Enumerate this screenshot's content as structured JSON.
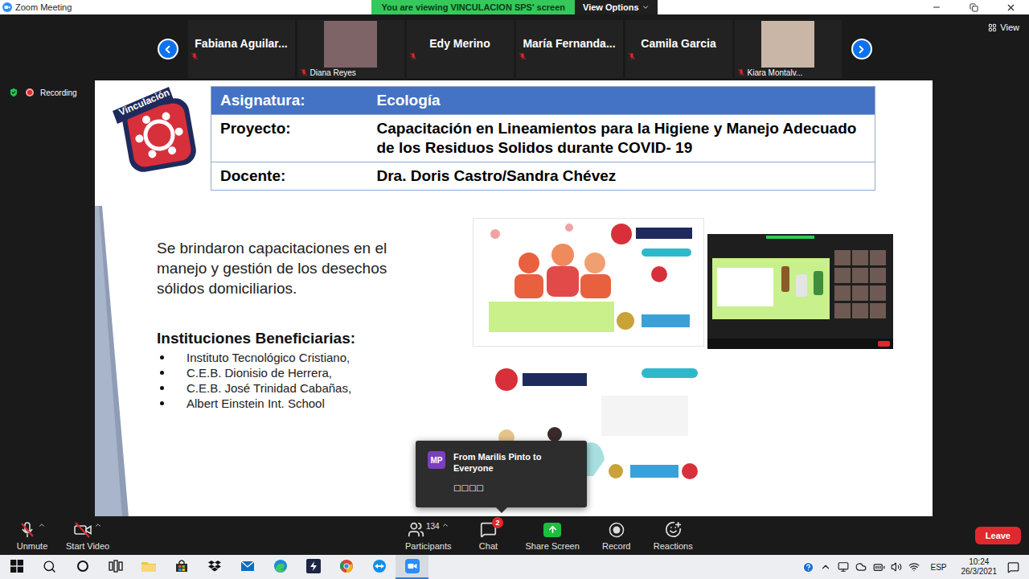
{
  "window": {
    "title": "Zoom Meeting"
  },
  "share_banner": {
    "text": "You are viewing VINCULACION SPS' screen",
    "view_options": "View Options"
  },
  "view_button": {
    "label": "View"
  },
  "recording": {
    "label": "Recording",
    "active": true
  },
  "participants": [
    {
      "name": "Fabiana Aguilar...",
      "kind": "name",
      "muted": true
    },
    {
      "name": "Diana Reyes",
      "kind": "photo",
      "muted": true
    },
    {
      "name": "Edy Merino",
      "kind": "name",
      "muted": true
    },
    {
      "name": "María Fernanda...",
      "kind": "name",
      "muted": true
    },
    {
      "name": "Camila Garcia",
      "kind": "name",
      "muted": true
    },
    {
      "name": "Kiara Montalv...",
      "kind": "photo",
      "muted": true
    }
  ],
  "slide": {
    "logo": "Vinculación",
    "table": [
      {
        "label": "Asignatura:",
        "value": "Ecología",
        "header": true
      },
      {
        "label": "Proyecto:",
        "value": "Capacitación en Lineamientos para la Higiene y Manejo Adecuado de los Residuos Solidos durante COVID- 19",
        "header": false
      },
      {
        "label": "Docente:",
        "value": "Dra. Doris Castro/Sandra Chévez",
        "header": false
      }
    ],
    "description": "Se brindaron capacitaciones en el manejo y gestión de los desechos sólidos domiciliarios.",
    "beneficiaries_title": "Instituciones Beneficiarias:",
    "beneficiaries": [
      "Instituto Tecnológico Cristiano,",
      "C.E.B. Dionisio de Herrera,",
      "C.E.B. José Trinidad Cabañas,",
      "Albert Einstein Int. School"
    ],
    "images": [
      {
        "kind": "hygiene"
      },
      {
        "kind": "screenshot"
      },
      {
        "kind": "waste"
      }
    ]
  },
  "chat_toast": {
    "avatar": "MP",
    "from": "From Marilis Pinto to Everyone",
    "message": "□□□□"
  },
  "toolbar": {
    "left": [
      {
        "label": "Unmute",
        "kind": "mic",
        "off": true
      },
      {
        "label": "Start Video",
        "kind": "video",
        "off": true
      }
    ],
    "center": [
      {
        "label": "Participants",
        "kind": "participants",
        "count": "134"
      },
      {
        "label": "Chat",
        "kind": "chat",
        "badge": "2"
      },
      {
        "label": "Share Screen",
        "kind": "share"
      },
      {
        "label": "Record",
        "kind": "record"
      },
      {
        "label": "Reactions",
        "kind": "reactions"
      }
    ],
    "leave": "Leave"
  },
  "taskbar": {
    "apps": [
      {
        "kind": "start",
        "active": false
      },
      {
        "kind": "search",
        "active": false
      },
      {
        "kind": "cortana",
        "active": false
      },
      {
        "kind": "taskview",
        "active": false
      },
      {
        "kind": "explorer",
        "active": false
      },
      {
        "kind": "store",
        "active": false
      },
      {
        "kind": "dropbox",
        "active": false
      },
      {
        "kind": "mail",
        "active": false
      },
      {
        "kind": "edge",
        "active": false
      },
      {
        "kind": "app",
        "active": false
      },
      {
        "kind": "chrome",
        "active": false
      },
      {
        "kind": "teamviewer",
        "active": false
      },
      {
        "kind": "zoom",
        "active": true
      }
    ],
    "tray": [
      "help",
      "chevron",
      "monitor",
      "cloud",
      "battery",
      "volume",
      "wifi"
    ],
    "language": "ESP",
    "time": "10:24",
    "date": "26/3/2021"
  }
}
